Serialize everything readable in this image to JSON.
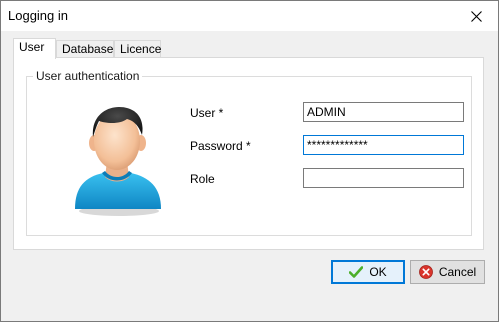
{
  "window": {
    "title": "Logging in"
  },
  "tabs": [
    {
      "label": "User",
      "active": true
    },
    {
      "label": "Database",
      "active": false
    },
    {
      "label": "Licence",
      "active": false
    }
  ],
  "user_panel": {
    "group_title": "User authentication",
    "fields": {
      "user": {
        "label": "User *",
        "value": "ADMIN"
      },
      "password": {
        "label": "Password *",
        "value": "*************"
      },
      "role": {
        "label": "Role",
        "value": ""
      }
    }
  },
  "buttons": {
    "ok": {
      "label": "OK",
      "icon": "checkmark-icon"
    },
    "cancel": {
      "label": "Cancel",
      "icon": "cancel-icon"
    }
  },
  "colors": {
    "focus_border": "#0078d7",
    "shirt": "#1ba4d9",
    "hair": "#2a2a2a",
    "skin": "#f6c9a4",
    "ok_icon": "#4caf2a",
    "cancel_icon": "#d9342b"
  }
}
